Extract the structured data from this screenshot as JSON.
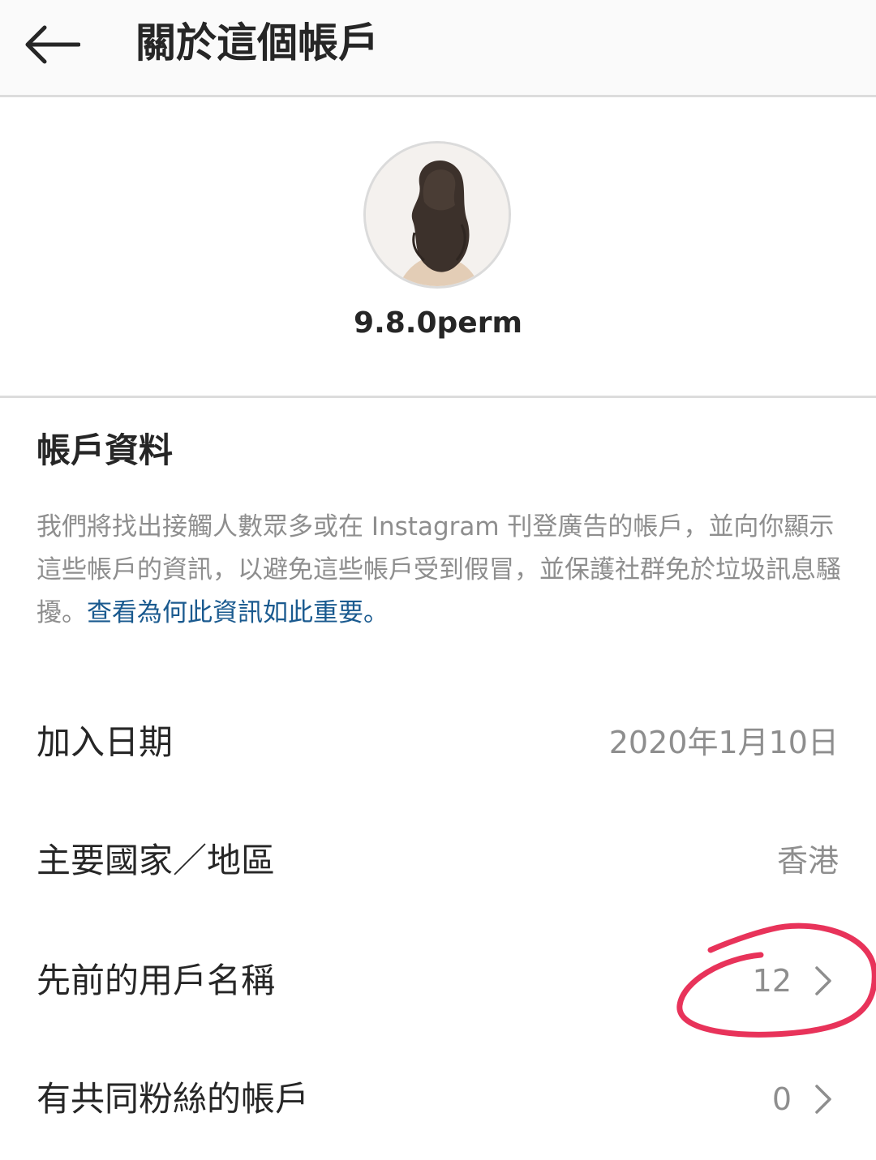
{
  "header": {
    "title": "關於這個帳戶",
    "back_icon": "arrow-left-icon"
  },
  "profile": {
    "username": "9.8.0perm"
  },
  "account_info": {
    "title": "帳戶資料",
    "description": "我們將找出接觸人數眾多或在 Instagram 刊登廣告的帳戶，並向你顯示這些帳戶的資訊，以避免這些帳戶受到假冒，並保護社群免於垃圾訊息騷擾。",
    "link_text": "查看為何此資訊如此重要。"
  },
  "rows": [
    {
      "label": "加入日期",
      "value": "2020年1月10日"
    },
    {
      "label": "主要國家／地區",
      "value": "香港"
    },
    {
      "label": "先前的用戶名稱",
      "value": "12"
    },
    {
      "label": "有共同粉絲的帳戶",
      "value": "0"
    }
  ],
  "colors": {
    "link": "#1a5a8f",
    "annotation": "#e8335a",
    "secondary_text": "#8e8e8e"
  }
}
